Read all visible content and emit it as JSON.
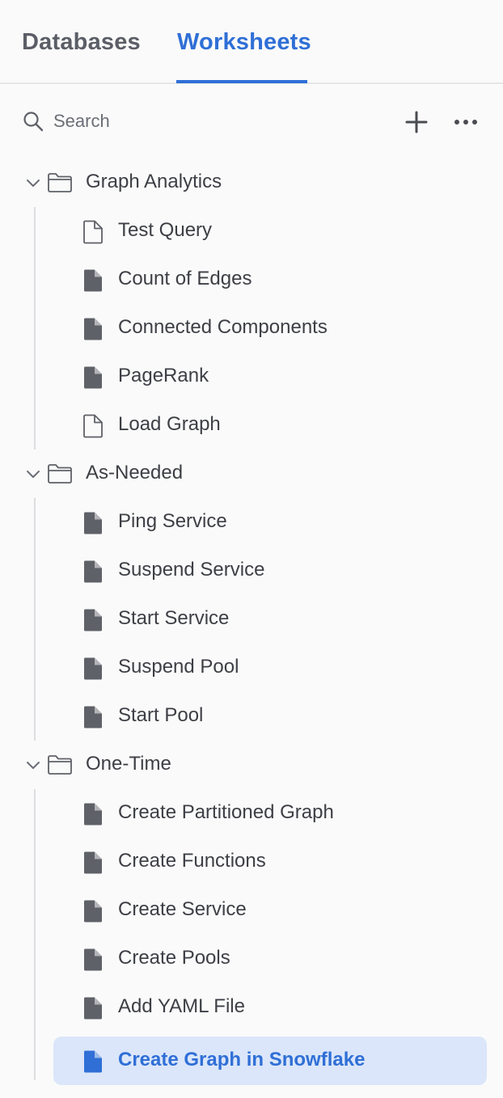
{
  "tabs": {
    "databases": "Databases",
    "worksheets": "Worksheets",
    "active": "worksheets"
  },
  "search": {
    "placeholder": "Search",
    "value": ""
  },
  "toolbar": {
    "add_icon": "plus-icon",
    "more_icon": "ellipsis-icon"
  },
  "colors": {
    "accent": "#2f6fd6",
    "selected_background": "#dbe6fa",
    "icon_dark": "#5f6168"
  },
  "folders": [
    {
      "name": "Graph Analytics",
      "expanded": true,
      "files": [
        {
          "name": "Test Query",
          "icon": "file-outline-icon"
        },
        {
          "name": "Count of Edges",
          "icon": "file-filled-icon"
        },
        {
          "name": "Connected Components",
          "icon": "file-filled-icon"
        },
        {
          "name": "PageRank",
          "icon": "file-filled-icon"
        },
        {
          "name": "Load Graph",
          "icon": "file-outline-icon"
        }
      ]
    },
    {
      "name": "As-Needed",
      "expanded": true,
      "files": [
        {
          "name": "Ping Service",
          "icon": "file-filled-icon"
        },
        {
          "name": "Suspend Service",
          "icon": "file-filled-icon"
        },
        {
          "name": "Start Service",
          "icon": "file-filled-icon"
        },
        {
          "name": "Suspend Pool",
          "icon": "file-filled-icon"
        },
        {
          "name": "Start Pool",
          "icon": "file-filled-icon"
        }
      ]
    },
    {
      "name": "One-Time",
      "expanded": true,
      "files": [
        {
          "name": "Create Partitioned Graph",
          "icon": "file-filled-icon"
        },
        {
          "name": "Create Functions",
          "icon": "file-filled-icon"
        },
        {
          "name": "Create Service",
          "icon": "file-filled-icon"
        },
        {
          "name": "Create Pools",
          "icon": "file-filled-icon"
        },
        {
          "name": "Add YAML File",
          "icon": "file-filled-icon"
        },
        {
          "name": "Create Graph in Snowflake",
          "icon": "file-filled-icon",
          "selected": true
        }
      ]
    }
  ]
}
